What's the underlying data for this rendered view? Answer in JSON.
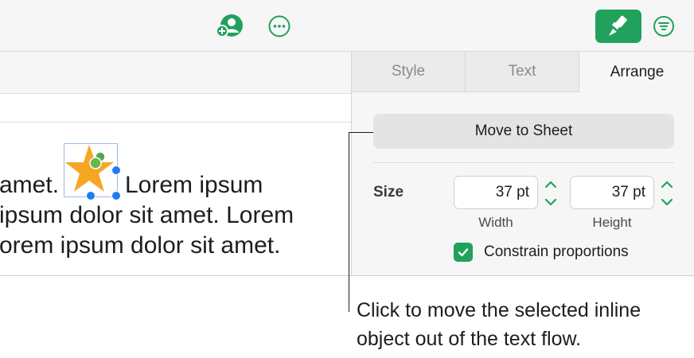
{
  "document": {
    "line1_before": "amet.",
    "line1_after": "Lorem ipsum",
    "line2": "ipsum dolor sit amet. Lorem",
    "line3": "orem ipsum dolor sit amet."
  },
  "sidebar": {
    "tabs": [
      {
        "label": "Style"
      },
      {
        "label": "Text"
      },
      {
        "label": "Arrange"
      }
    ],
    "move_button": "Move to Sheet",
    "size_label": "Size",
    "width_value": "37 pt",
    "width_caption": "Width",
    "height_value": "37 pt",
    "height_caption": "Height",
    "constrain_label": "Constrain proportions",
    "constrain_checked": true
  },
  "callout": {
    "line1": "Click to move the selected inline",
    "line2": "object out of the text flow."
  },
  "icons": {
    "collaborate": "collaborate-icon",
    "more": "more-icon",
    "format": "paintbrush-icon",
    "organize": "organize-icon",
    "star": "star-shape"
  },
  "colors": {
    "accent": "#21a15c",
    "selection": "#1f7cf3",
    "star": "#f6a623"
  }
}
